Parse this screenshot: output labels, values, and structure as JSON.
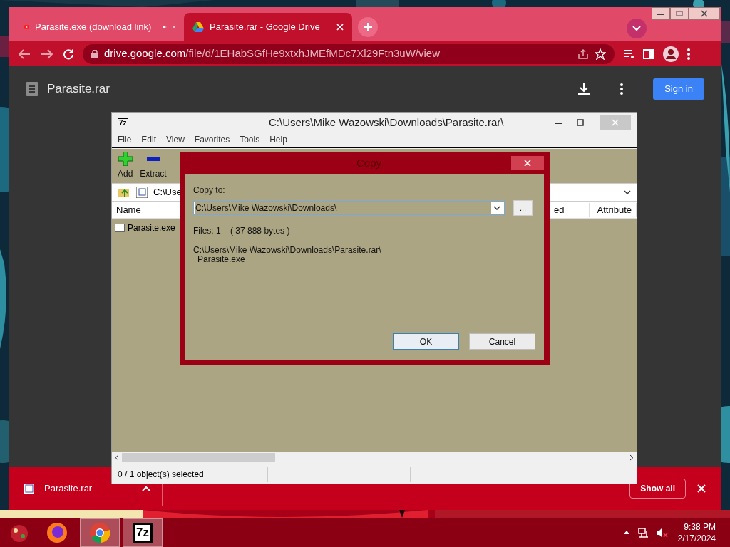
{
  "browser": {
    "tabs": [
      {
        "title": "Parasite.exe (download link)",
        "selected": false,
        "audio": true,
        "kind": "video"
      },
      {
        "title": "Parasite.rar - Google Drive",
        "selected": true,
        "audio": false,
        "kind": "drive"
      }
    ],
    "url": {
      "host": "drive.google.com",
      "path": "/file/d/1EHabSGfHe9xtxhJMEfMDc7Xl29Ftn3uW/view"
    }
  },
  "drive": {
    "file_name": "Parasite.rar",
    "sign_in": "Sign in"
  },
  "archiver": {
    "logo": "7z",
    "title": "C:\\Users\\Mike Wazowski\\Downloads\\Parasite.rar\\",
    "menu": [
      "File",
      "Edit",
      "View",
      "Favorites",
      "Tools",
      "Help"
    ],
    "toolbar": [
      {
        "label": "Add",
        "kind": "add"
      },
      {
        "label": "Extract",
        "kind": "extract"
      }
    ],
    "address": "C:\\Use",
    "columns": [
      "Name",
      "ed",
      "Attribute"
    ],
    "files": [
      "Parasite.exe"
    ],
    "status": "0 / 1 object(s) selected"
  },
  "dialog": {
    "title": "Copy",
    "label": "Copy to:",
    "value": "C:\\Users\\Mike Wazowski\\Downloads\\",
    "browse": "...",
    "info": "Files: 1    ( 37 888 bytes )",
    "source_lines": [
      "C:\\Users\\Mike Wazowski\\Downloads\\Parasite.rar\\",
      "Parasite.exe"
    ],
    "buttons": [
      {
        "label": "OK",
        "selected": true
      },
      {
        "label": "Cancel",
        "selected": false
      }
    ]
  },
  "download_bar": {
    "item": "Parasite.rar",
    "show_all": "Show all"
  },
  "taskbar": {
    "apps": [
      {
        "kind": "firefox",
        "selected": false
      },
      {
        "kind": "chrome",
        "selected": true
      },
      {
        "kind": "archiver",
        "selected": true,
        "logo": "7z"
      }
    ],
    "time": "9:38 PM",
    "date": "2/17/2024"
  }
}
